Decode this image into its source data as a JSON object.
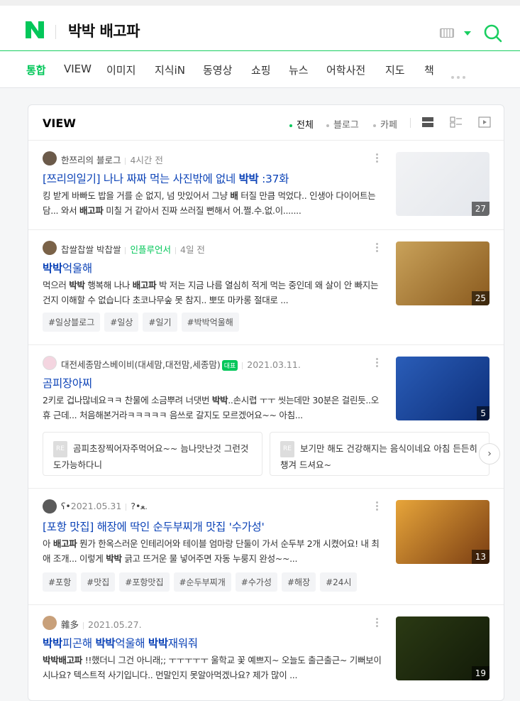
{
  "header": {
    "query": "박박 배고파",
    "logo": "N"
  },
  "tabs": [
    {
      "label": "통합",
      "active": true
    },
    {
      "label": "VIEW"
    },
    {
      "label": "이미지"
    },
    {
      "label": "지식iN"
    },
    {
      "label": "동영상"
    },
    {
      "label": "쇼핑"
    },
    {
      "label": "뉴스"
    },
    {
      "label": "어학사전"
    },
    {
      "label": "지도"
    },
    {
      "label": "책"
    }
  ],
  "panel": {
    "title": "VIEW",
    "filters": [
      {
        "label": "전체",
        "active": true
      },
      {
        "label": "블로그"
      },
      {
        "label": "카페"
      }
    ]
  },
  "items": [
    {
      "author": "한쯔리의 블로그",
      "time": "4시간 전",
      "title_parts": [
        "[쯔리의일기] 나나 짜짜 먹는 사진밖에 없네 ",
        "박박",
        " :37화"
      ],
      "desc_html": "킹 받게 바빠도 밥을 거를 순 없지, 넘 맛있어서 그냥 <b>배</b> 터질 만큼 먹었다.. 인생아 다이어트는 담... 와서 <b>배고파</b> 미칠 거 같아서 진짜 쓰러질 뻔해서 어.쩔.수.없.이.......",
      "count": "27",
      "thumb_colors": [
        "#f2f3f5",
        "#e4e7ec"
      ]
    },
    {
      "author": "찹쌀찹쌀 박찹쌀",
      "influencer": "인플루언서",
      "time": "4일 전",
      "title_parts": [
        "",
        "박박",
        "억울해"
      ],
      "desc_html": "먹으러 <b>박박</b> 행복해 나나 <b>배고파</b> 박 저는 지금 나름 열심히 적게 먹는 중인데 왜 살이 안 빠지는 건지 이해할 수 없습니다 초코나무숲 못 참지.. 뽀또 마카롱 절대로 ...",
      "tags": [
        "#일상블로그",
        "#일상",
        "#일기",
        "#박박억울해"
      ],
      "count": "25",
      "thumb_colors": [
        "#c9a25a",
        "#8a5a1e"
      ]
    },
    {
      "author": "대전세종맘스베이비(대세맘,대전맘,세종맘)",
      "badge": "대표",
      "time": "2021.03.11.",
      "title_parts": [
        "곰피장아찌",
        "",
        ""
      ],
      "desc_html": "2키로 겁나많네요ㅋㅋ 찬물에 소금뿌려 너댓번 <b>박박</b>..손시렵 ㅜㅜ 씻는데만 30분은 걸린듯..오휴 근데... 처음해본거라ㅋㅋㅋㅋㅋ 음쓰로 갈지도 모르겠어요~~ 아침...",
      "comments": [
        "곰피초장찍어자주먹어요~~ 늠나맛난것 그런것도가능하다니",
        "보기만 해도 건강해지는 음식이네요 아침 든든히 챙겨 드셔요~"
      ],
      "comment_tag": "RE",
      "count": "5",
      "thumb_colors": [
        "#2a5db8",
        "#0d2f7a"
      ]
    },
    {
      "author": "ʕ•ﻌ•?",
      "time": "2021.05.31.",
      "title_parts": [
        "[포항 맛집] 해장에 딱인 순두부찌개 맛집 '수가성'",
        "",
        ""
      ],
      "desc_html": "아 <b>배고파</b> 뭔가 한옥스러운 인테리어와 테이블 엄마랑 단둘이 가서 순두부 2개 시켰어요! 내 최애 조개... 이렇게 <b>박박</b> 긁고 뜨거운 물 넣어주면 자동 누룽지 완성~~...",
      "tags": [
        "#포항",
        "#맛집",
        "#포항맛집",
        "#순두부찌개",
        "#수가성",
        "#해장",
        "#24시"
      ],
      "count": "13",
      "thumb_colors": [
        "#e7a53a",
        "#7a3d12"
      ]
    },
    {
      "author": "雜多",
      "time": "2021.05.27.",
      "title_parts": [
        "",
        "박박",
        "피곤해 <b>박박</b>억울해 <b>박박</b>재워줘"
      ],
      "desc_html": "<b>박박배고파</b> !!했더니 그건 아니래;; ㅜㅜㅜㅜㅜ 울학교 꽃 예쁘지~ 오늘도 출근출근~ 기뻐보이시나요? 텍스트적 사기입니다.. 먼말인지 못알아먹겠나요? 제가 많이 ...",
      "count": "19",
      "thumb_colors": [
        "#2b3a14",
        "#121a08"
      ]
    }
  ],
  "colors": {
    "accent": "#03c75a",
    "link": "#0c43b7"
  },
  "icons": [
    "logo-icon",
    "keyboard-icon",
    "dropdown-caret-icon",
    "search-icon",
    "more-dots-icon",
    "list-view-icon",
    "card-view-icon",
    "video-view-icon",
    "kebab-icon",
    "next-arrow-icon"
  ]
}
